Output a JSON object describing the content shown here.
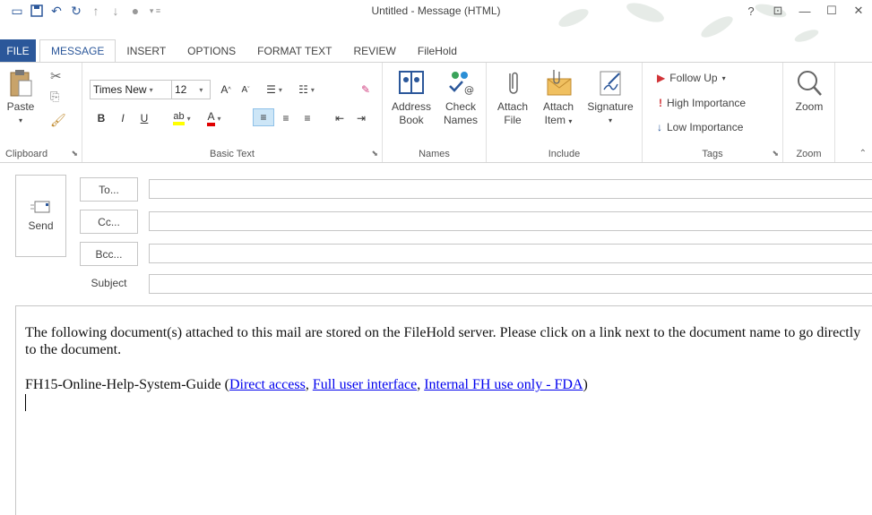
{
  "window": {
    "title": "Untitled - Message (HTML)",
    "help": "?",
    "controls": [
      "ribbon-display",
      "minimize",
      "maximize",
      "close"
    ]
  },
  "tabs": [
    {
      "label": "FILE",
      "active": false
    },
    {
      "label": "MESSAGE",
      "active": true
    },
    {
      "label": "INSERT",
      "active": false
    },
    {
      "label": "OPTIONS",
      "active": false
    },
    {
      "label": "FORMAT TEXT",
      "active": false
    },
    {
      "label": "REVIEW",
      "active": false
    },
    {
      "label": "FileHold",
      "active": false
    }
  ],
  "ribbon": {
    "clipboard": {
      "label": "Clipboard",
      "paste": "Paste"
    },
    "basic_text": {
      "label": "Basic Text",
      "font": "Times New",
      "size": "12",
      "bold": "B",
      "italic": "I",
      "underline": "U"
    },
    "names": {
      "label": "Names",
      "address_book_1": "Address",
      "address_book_2": "Book",
      "check_names_1": "Check",
      "check_names_2": "Names"
    },
    "include": {
      "label": "Include",
      "attach_file_1": "Attach",
      "attach_file_2": "File",
      "attach_item_1": "Attach",
      "attach_item_2": "Item",
      "signature": "Signature"
    },
    "tags": {
      "label": "Tags",
      "follow_up": "Follow Up",
      "high": "High Importance",
      "low": "Low Importance"
    },
    "zoom": {
      "label": "Zoom",
      "zoom": "Zoom"
    }
  },
  "header": {
    "send": "Send",
    "to": "To...",
    "cc": "Cc...",
    "bcc": "Bcc...",
    "subject": "Subject",
    "to_value": "",
    "cc_value": "",
    "bcc_value": "",
    "subject_value": ""
  },
  "body": {
    "intro": "The following document(s) attached to this mail are stored on the FileHold server. Please click on a link next to the document name to go directly to the document.",
    "doc_name": "FH15-Online-Help-System-Guide",
    "open_paren": " (",
    "link1": "Direct access",
    "sep1": ", ",
    "link2": "Full user interface",
    "sep2": ", ",
    "link3": "Internal FH use only - FDA",
    "close_paren": ")"
  },
  "colors": {
    "accent": "#2b579a",
    "link": "#0000ee",
    "flag": "#d13438"
  }
}
